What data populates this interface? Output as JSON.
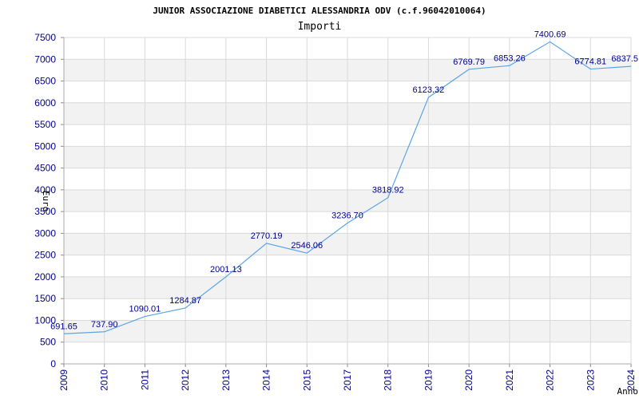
{
  "chart_data": {
    "type": "line",
    "title": "JUNIOR ASSOCIAZIONE DIABETICI ALESSANDRIA ODV (c.f.96042010064)",
    "subtitle": "Importi",
    "xlabel": "Anno",
    "ylabel": "Euro",
    "categories": [
      "2009",
      "2010",
      "2011",
      "2012",
      "2013",
      "2014",
      "2015",
      "2017",
      "2018",
      "2019",
      "2020",
      "2021",
      "2022",
      "2023",
      "2024"
    ],
    "values": [
      691.65,
      737.9,
      1090.01,
      1284.87,
      2001.13,
      2770.19,
      2546.06,
      3236.7,
      3818.92,
      6123.32,
      6769.79,
      6853.26,
      7400.69,
      6774.81,
      6837.5
    ],
    "value_labels": [
      "691.65",
      "737.90",
      "1090.01",
      "1284.87",
      "2001.13",
      "2770.19",
      "2546.06",
      "3236.70",
      "3818.92",
      "6123.32",
      "6769.79",
      "6853.26",
      "7400.69",
      "6774.81",
      "6837.5"
    ],
    "ylim": [
      0,
      7500
    ],
    "ytick_step": 500,
    "grid": true,
    "colors": {
      "line": "#5aa5e6",
      "band": "#f2f2f2",
      "grid": "#d9d9d9",
      "tick_text": "#00008b"
    }
  }
}
